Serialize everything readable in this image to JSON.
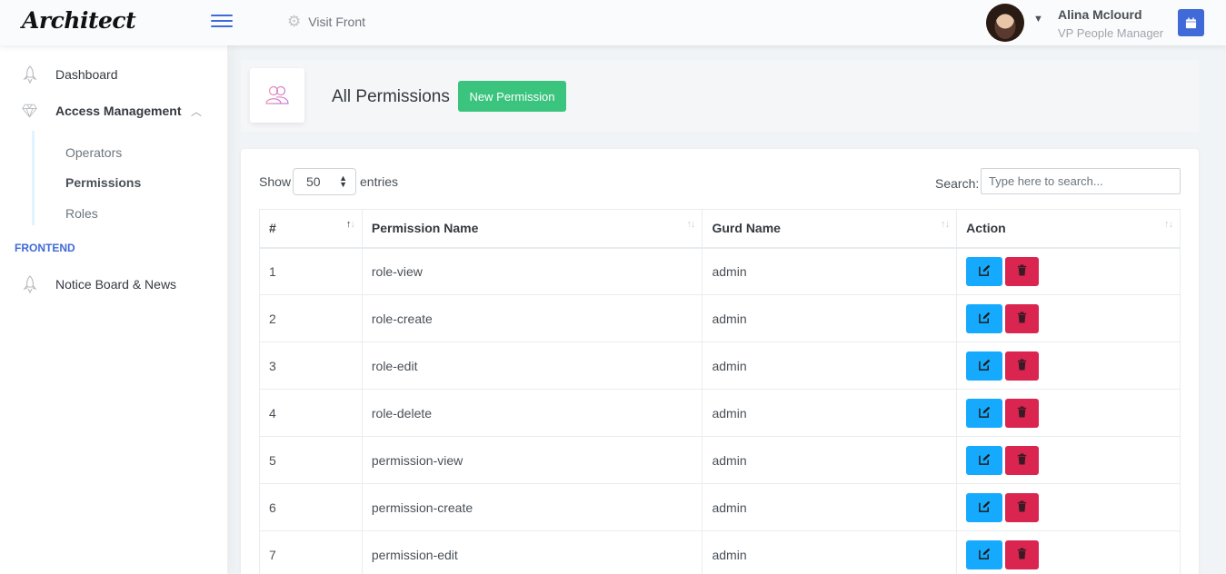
{
  "header": {
    "logo": "Architect",
    "visit_front": "Visit Front",
    "user_name": "Alina Mclourd",
    "user_role": "VP People Manager",
    "icons": [
      "hamburger-icon",
      "gear-icon",
      "chevron-down-icon",
      "calendar-icon"
    ]
  },
  "sidebar": {
    "items": [
      {
        "label": "Dashboard",
        "icon": "rocket-icon"
      },
      {
        "label": "Access Management",
        "icon": "diamond-icon"
      }
    ],
    "submenu": [
      {
        "label": "Operators"
      },
      {
        "label": "Permissions",
        "active": true
      },
      {
        "label": "Roles"
      }
    ],
    "section": "FRONTEND",
    "frontend_items": [
      {
        "label": "Notice Board & News",
        "icon": "rocket-icon"
      }
    ]
  },
  "page": {
    "title": "All Permissions",
    "new_button": "New Permission"
  },
  "table_controls": {
    "show_label": "Show",
    "page_size": "50",
    "entries_label": "entries",
    "search_label": "Search:",
    "search_placeholder": "Type here to search..."
  },
  "table": {
    "columns": [
      "#",
      "Permission Name",
      "Gurd Name",
      "Action"
    ],
    "rows": [
      {
        "id": "1",
        "name": "role-view",
        "guard": "admin"
      },
      {
        "id": "2",
        "name": "role-create",
        "guard": "admin"
      },
      {
        "id": "3",
        "name": "role-edit",
        "guard": "admin"
      },
      {
        "id": "4",
        "name": "role-delete",
        "guard": "admin"
      },
      {
        "id": "5",
        "name": "permission-view",
        "guard": "admin"
      },
      {
        "id": "6",
        "name": "permission-create",
        "guard": "admin"
      },
      {
        "id": "7",
        "name": "permission-edit",
        "guard": "admin"
      }
    ]
  },
  "colors": {
    "primary": "#3f6ad8",
    "success": "#3ac47d",
    "info": "#16aaff",
    "danger": "#d92550"
  }
}
